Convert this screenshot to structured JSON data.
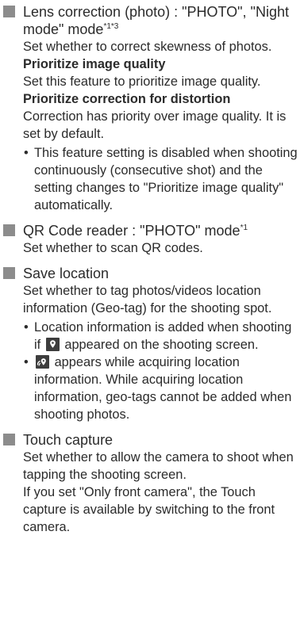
{
  "sections": [
    {
      "title": "Lens correction (photo) : \"PHOTO\", \"Night mode\" mode",
      "title_sup": "*1*3",
      "desc": "Set whether to correct skewness of photos.",
      "options": [
        {
          "name": "Prioritize image quality",
          "desc": "Set this feature to prioritize image quality."
        },
        {
          "name": "Prioritize correction for distortion",
          "desc": "Correction has priority over image quality. It is set by default."
        }
      ],
      "bullets": [
        "This feature setting is disabled when shooting continuously (consecutive shot) and the setting changes to \"Prioritize image quality\" automatically."
      ]
    },
    {
      "title": "QR Code reader : \"PHOTO\" mode",
      "title_sup": "*1",
      "desc": "Set whether to scan QR codes."
    },
    {
      "title": "Save location",
      "desc": "Set whether to tag photos/videos location information (Geo-tag) for the shooting spot.",
      "bullets": [
        {
          "before": "Location information is added when shooting if",
          "icon": "location-pin-icon",
          "after": "appeared on the shooting screen."
        },
        {
          "before": "",
          "icon": "acquiring-location-icon",
          "after": "appears while acquiring location information. While acquiring location information, geo-tags cannot be added when shooting photos."
        }
      ]
    },
    {
      "title": "Touch capture",
      "desc": "Set whether to allow the camera to shoot when tapping the shooting screen.",
      "desc2": "If you set \"Only front camera\", the Touch capture is available by switching to the front camera."
    }
  ],
  "colors": {
    "square": "#8c8c8c",
    "icon_bg": "#3d3d3d",
    "icon_fg": "#ffffff",
    "text": "#2b2b2b"
  }
}
